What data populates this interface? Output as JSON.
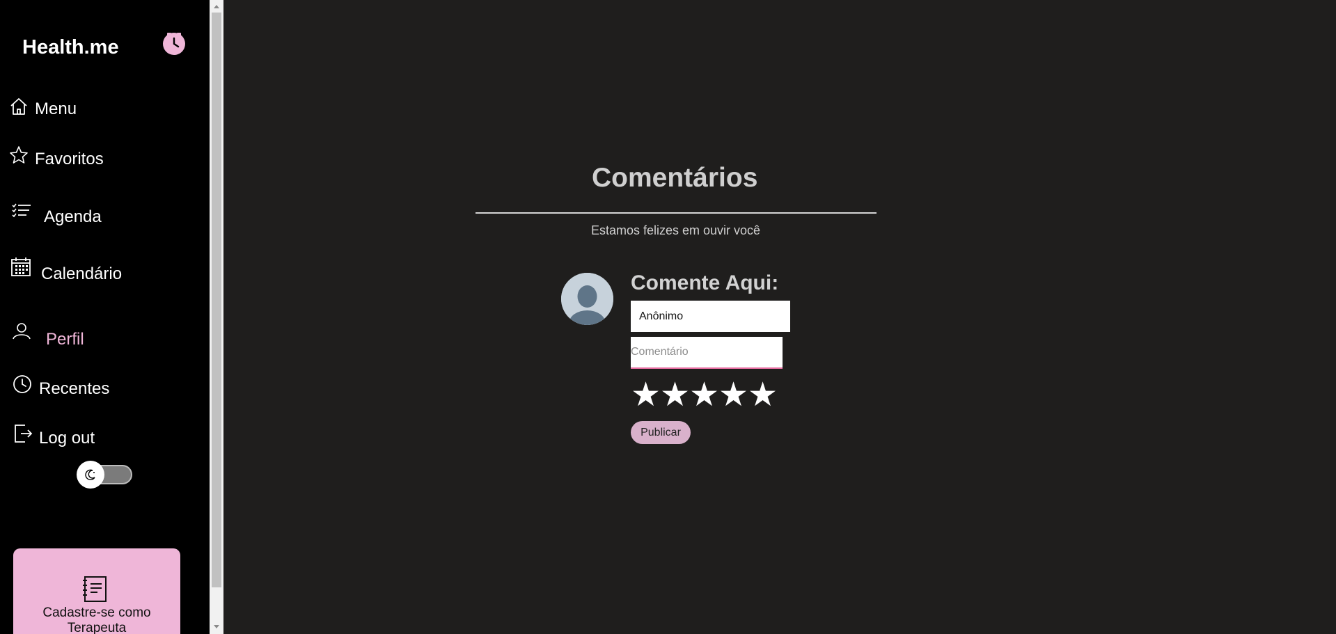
{
  "sidebar": {
    "logo": "Health.me",
    "items": [
      {
        "label": "Menu",
        "icon": "home-icon"
      },
      {
        "label": "Favoritos",
        "icon": "star-icon"
      },
      {
        "label": "Agenda",
        "icon": "list-icon"
      },
      {
        "label": "Calendário",
        "icon": "calendar-icon"
      },
      {
        "label": "Perfil",
        "icon": "user-icon",
        "active": true
      },
      {
        "label": "Recentes",
        "icon": "clock-icon"
      },
      {
        "label": "Log out",
        "icon": "logout-icon"
      }
    ],
    "theme_toggle_icon": "moon-icon",
    "register_card": {
      "icon": "document-icon",
      "label": "Cadastre-se como Terapeuta"
    }
  },
  "main": {
    "title": "Comentários",
    "subtitle": "Estamos felizes em ouvir você",
    "form": {
      "heading": "Comente Aqui:",
      "name_value": "Anônimo",
      "comment_placeholder": "Comentário",
      "stars": [
        "★",
        "★",
        "★",
        "★",
        "★"
      ],
      "publish_label": "Publicar"
    }
  },
  "colors": {
    "accent_pink": "#efb6d8",
    "background": "#1f1e1d",
    "sidebar": "#000000"
  }
}
